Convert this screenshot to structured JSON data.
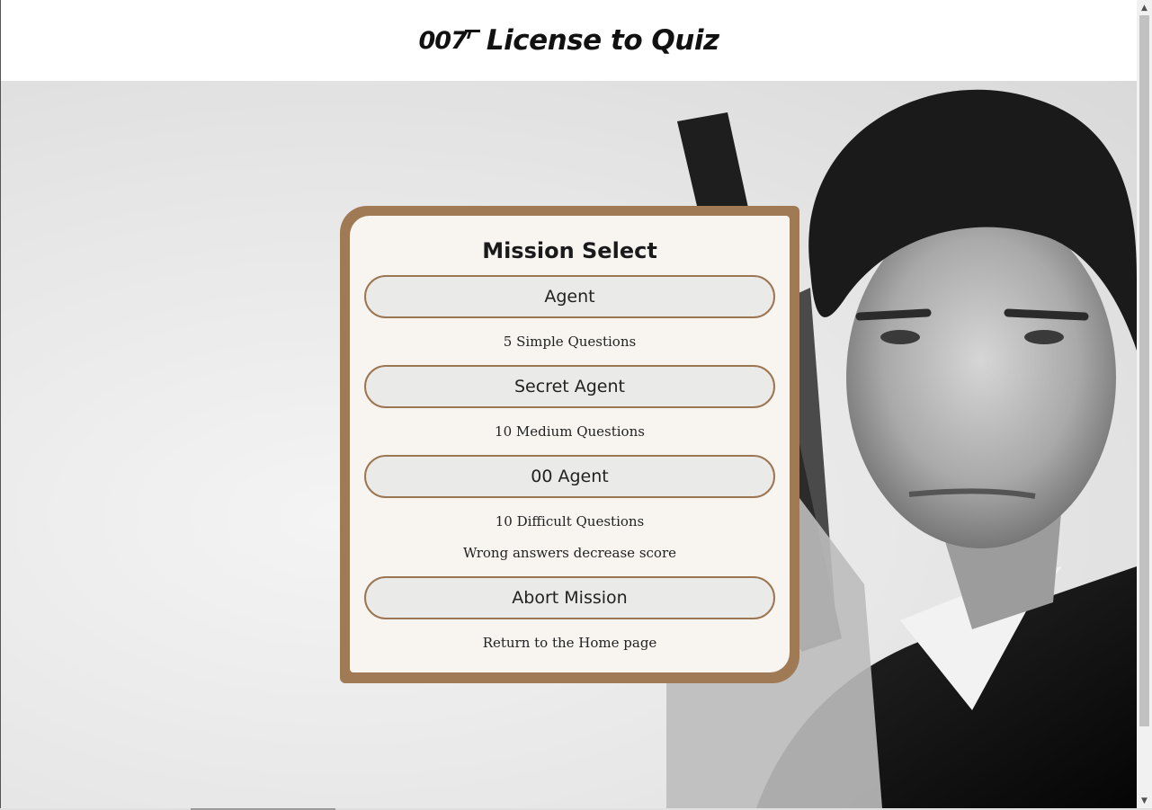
{
  "header": {
    "logo_text": "007",
    "title": "License to Quiz"
  },
  "mission": {
    "heading": "Mission Select",
    "options": [
      {
        "label": "Agent",
        "description": "5 Simple Questions"
      },
      {
        "label": "Secret Agent",
        "description": "10 Medium Questions"
      },
      {
        "label": "00 Agent",
        "description": "10 Difficult Questions",
        "note": "Wrong answers decrease score"
      }
    ],
    "abort": {
      "label": "Abort Mission",
      "description": "Return to the Home page"
    }
  },
  "icons": {
    "logo": "gun-logo-icon",
    "scroll_up": "scroll-up-arrow-icon",
    "scroll_down": "scroll-down-arrow-icon"
  },
  "colors": {
    "accent": "#9b7652",
    "frame": "#a07a55",
    "button_bg": "#e8e8e8"
  }
}
